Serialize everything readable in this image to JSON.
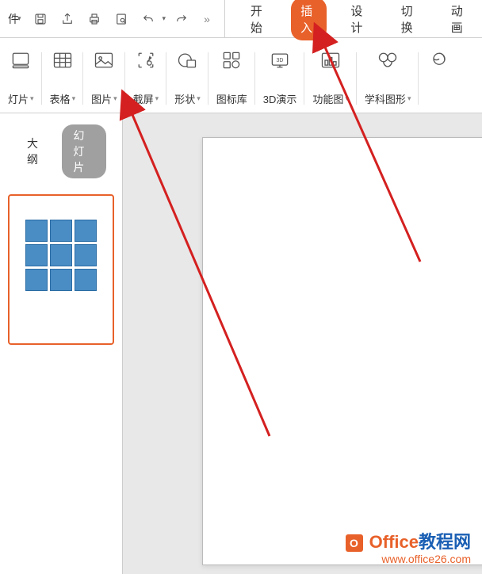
{
  "topbar": {
    "file_label": "件",
    "more_symbol": "»"
  },
  "tabs": {
    "start": "开始",
    "insert": "插入",
    "design": "设计",
    "transition": "切换",
    "animation": "动画"
  },
  "ribbon": {
    "slides": "灯片",
    "table": "表格",
    "picture": "图片",
    "screenshot": "截屏",
    "shapes": "形状",
    "icon_library": "图标库",
    "3d_demo": "3D演示",
    "function_chart": "功能图",
    "subject_shapes": "学科图形"
  },
  "panel": {
    "outline": "大纲",
    "slides": "幻灯片"
  },
  "watermark": {
    "line1_a": "Office",
    "line1_b": "教程网",
    "line2": "www.office26.com",
    "badge": "O"
  }
}
